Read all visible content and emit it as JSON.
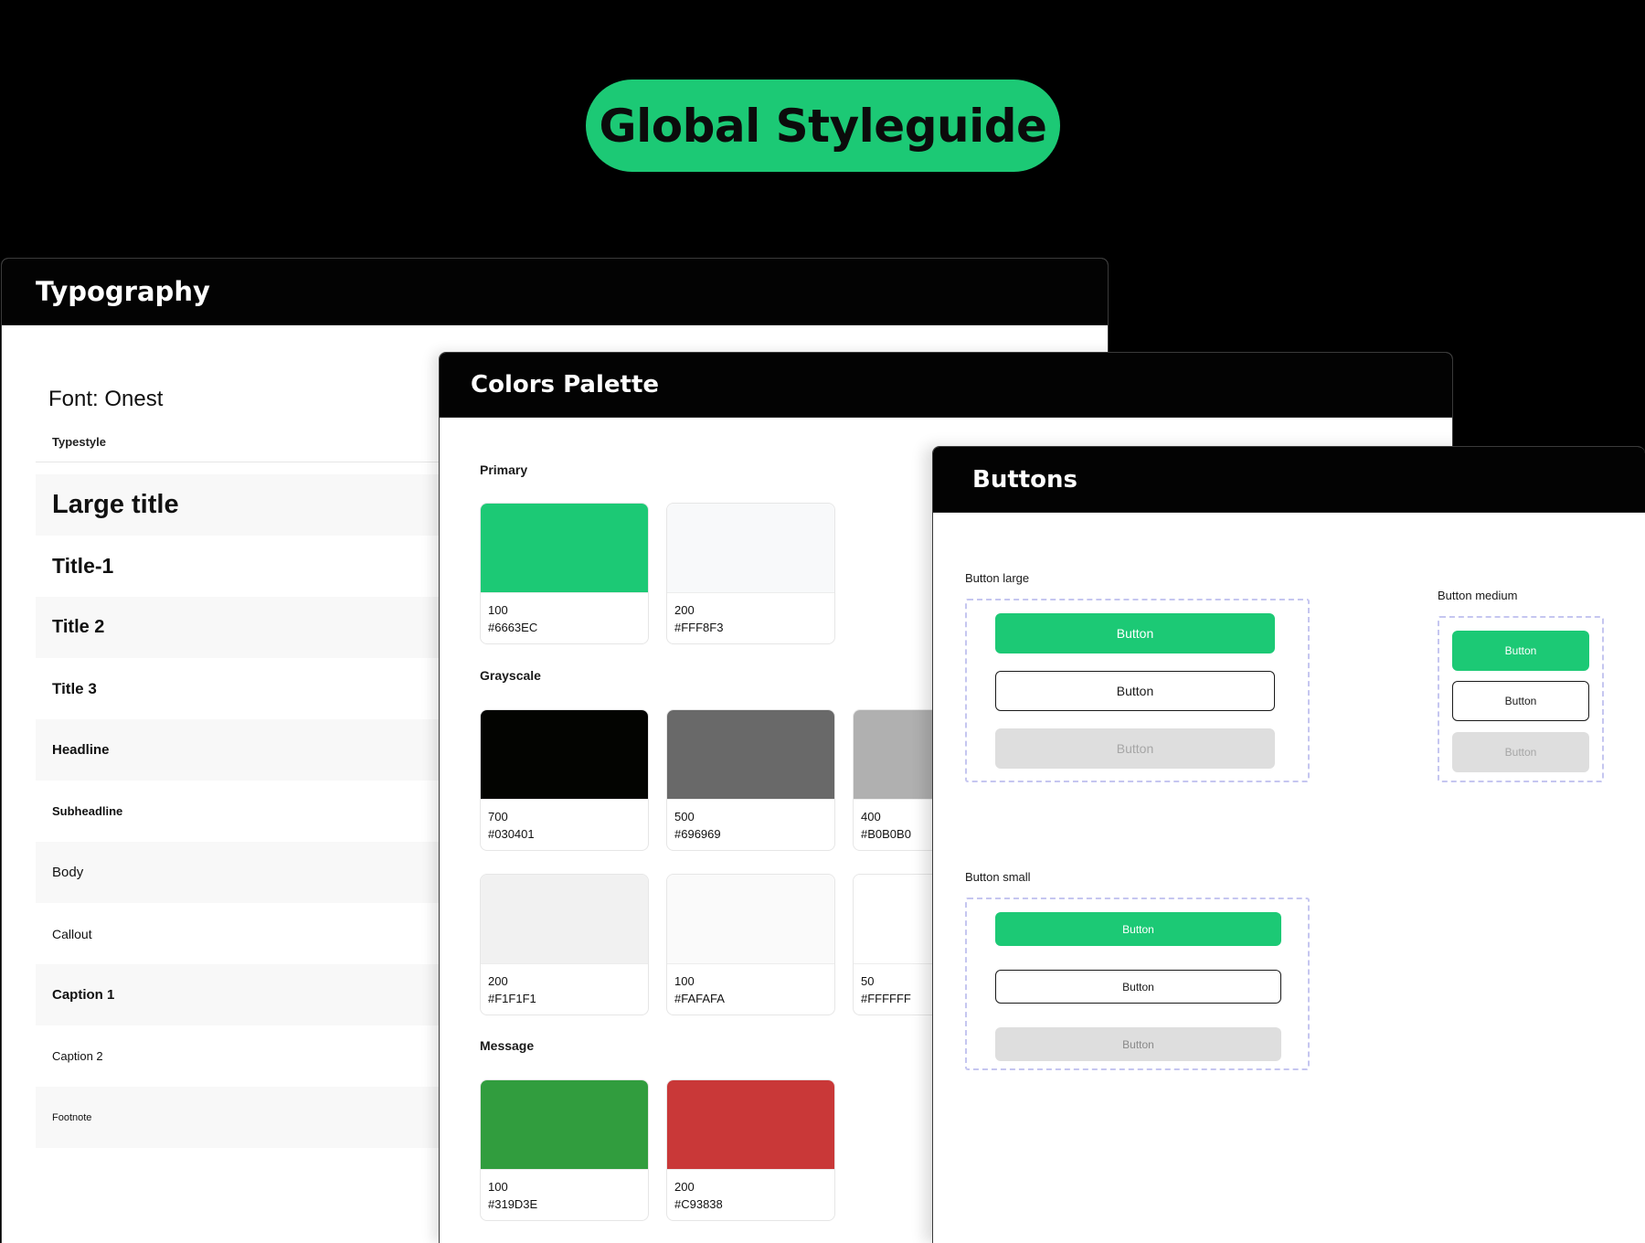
{
  "hero": {
    "title": "Global Styleguide"
  },
  "typography": {
    "title": "Typography",
    "font_label": "Font: Onest",
    "column_header": "Typestyle",
    "styles": [
      "Large title",
      "Title-1",
      "Title 2",
      "Title 3",
      "Headline",
      "Subheadline",
      "Body",
      "Callout",
      "Caption 1",
      "Caption 2",
      "Footnote"
    ]
  },
  "colors": {
    "title": "Colors Palette",
    "primary_label": "Primary",
    "primary": [
      {
        "num": "100",
        "hex": "#6663EC",
        "color": "#1cc975"
      },
      {
        "num": "200",
        "hex": "#FFF8F3",
        "color": "#f8f9fa"
      }
    ],
    "grayscale_label": "Grayscale",
    "grayscale": [
      {
        "num": "700",
        "hex": "#030401",
        "color": "#030401"
      },
      {
        "num": "500",
        "hex": "#696969",
        "color": "#696969"
      },
      {
        "num": "400",
        "hex": "#B0B0B0",
        "color": "#b0b0b0"
      },
      {
        "num": "200",
        "hex": "#F1F1F1",
        "color": "#f1f1f1"
      },
      {
        "num": "100",
        "hex": "#FAFAFA",
        "color": "#fafafa"
      },
      {
        "num": "50",
        "hex": "#FFFFFF",
        "color": "#ffffff"
      }
    ],
    "message_label": "Message",
    "message": [
      {
        "num": "100",
        "hex": "#319D3E",
        "color": "#319d3e"
      },
      {
        "num": "200",
        "hex": "#C93838",
        "color": "#c93838"
      }
    ]
  },
  "buttons": {
    "title": "Buttons",
    "large_label": "Button large",
    "medium_label": "Button medium",
    "small_label": "Button small",
    "button_text": "Button"
  }
}
